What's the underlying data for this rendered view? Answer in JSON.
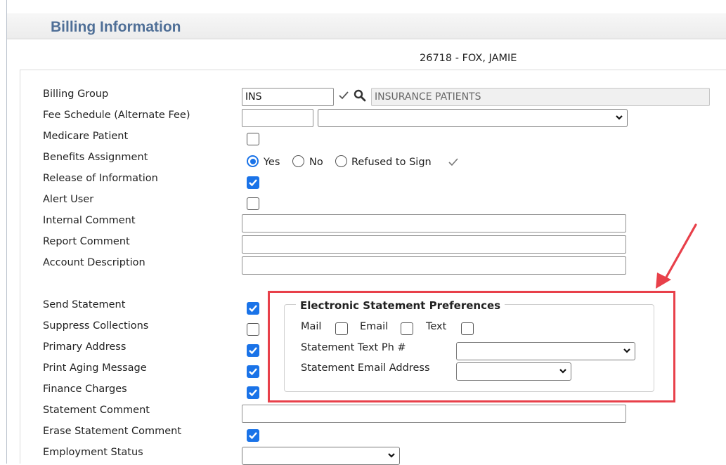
{
  "page": {
    "title": "Billing Information",
    "patient_header": "26718 - FOX, JAMIE"
  },
  "fields": {
    "billing_group": {
      "label": "Billing Group",
      "code": "INS",
      "description": "INSURANCE PATIENTS"
    },
    "fee_schedule": {
      "label": "Fee Schedule (Alternate Fee)",
      "code": "",
      "selected": ""
    },
    "medicare_patient": {
      "label": "Medicare Patient",
      "checked": false
    },
    "benefits_assignment": {
      "label": "Benefits Assignment",
      "options": [
        "Yes",
        "No",
        "Refused to Sign"
      ],
      "selected": "Yes"
    },
    "release_of_information": {
      "label": "Release of Information",
      "checked": true
    },
    "alert_user": {
      "label": "Alert User",
      "checked": false
    },
    "internal_comment": {
      "label": "Internal Comment",
      "value": ""
    },
    "report_comment": {
      "label": "Report Comment",
      "value": ""
    },
    "account_description": {
      "label": "Account Description",
      "value": ""
    },
    "send_statement": {
      "label": "Send Statement",
      "checked": true
    },
    "suppress_collections": {
      "label": "Suppress Collections",
      "checked": false
    },
    "primary_address": {
      "label": "Primary Address",
      "checked": true
    },
    "print_aging_message": {
      "label": "Print Aging Message",
      "checked": true
    },
    "finance_charges": {
      "label": "Finance Charges",
      "checked": true
    },
    "statement_comment": {
      "label": "Statement Comment",
      "value": ""
    },
    "erase_statement_comment": {
      "label": "Erase Statement Comment",
      "checked": true
    },
    "employment_status": {
      "label": "Employment Status",
      "selected": ""
    }
  },
  "electronic_statement": {
    "title": "Electronic Statement Preferences",
    "mail_label": "Mail",
    "mail_checked": false,
    "email_label": "Email",
    "email_checked": false,
    "text_label": "Text",
    "text_checked": false,
    "text_phone_label": "Statement Text Ph #",
    "text_phone_selected": "",
    "email_address_label": "Statement Email Address",
    "email_address_selected": ""
  },
  "colors": {
    "accent": "#1a73e8",
    "title": "#4f6f97",
    "highlight": "#e8404a"
  }
}
